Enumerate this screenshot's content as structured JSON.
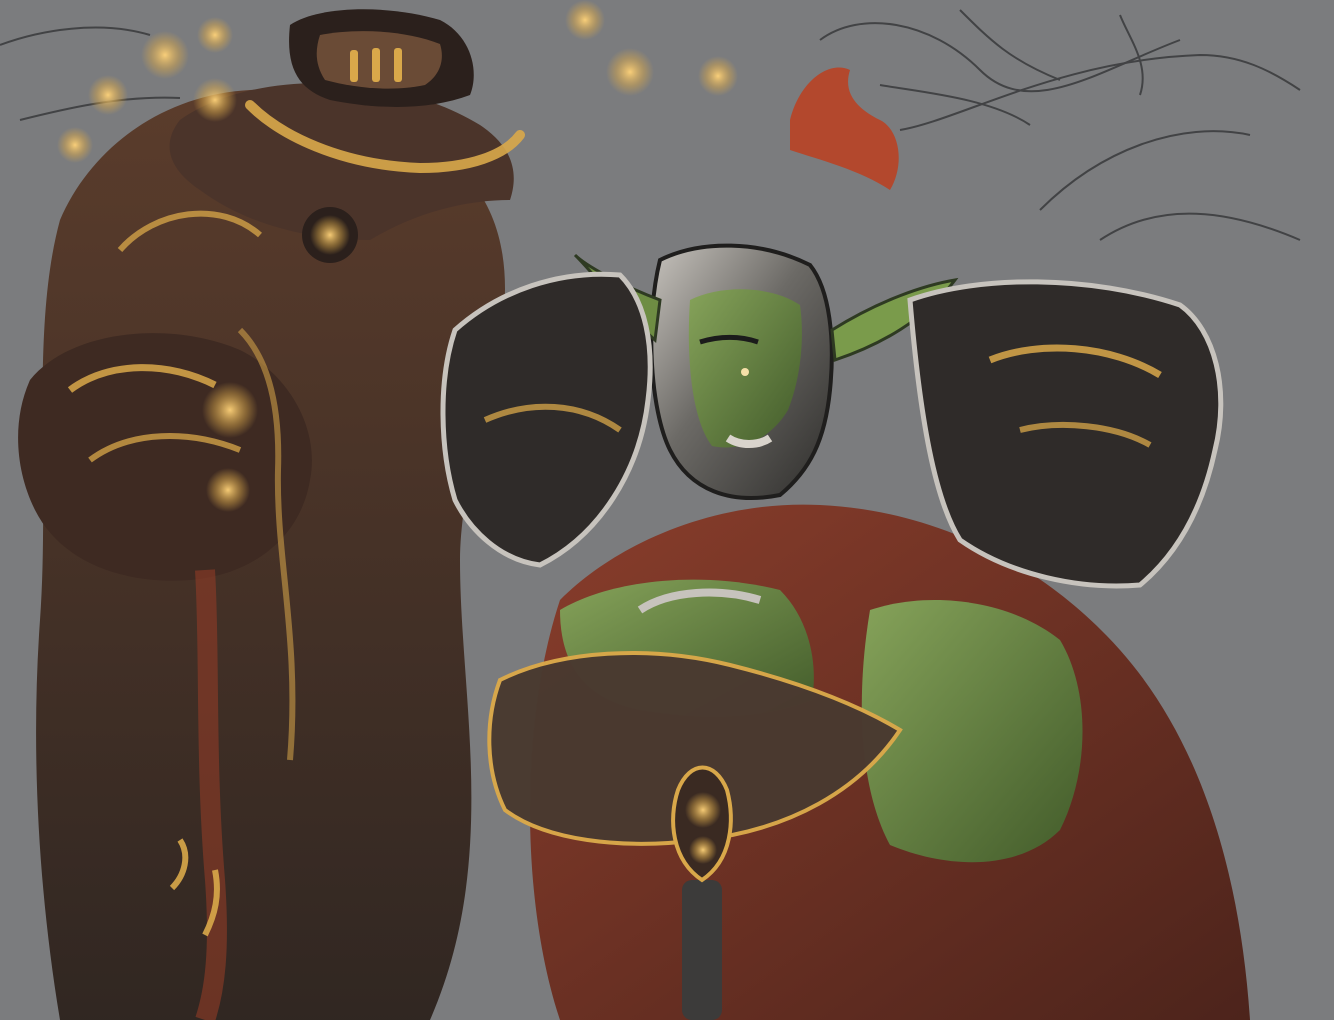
{
  "artwork": {
    "subject": "",
    "colors": {
      "background": "#7b7c7e",
      "sketch_line": "#2f3032",
      "dark_brown": "#3b2a22",
      "mid_brown": "#5a3b2a",
      "gold": "#d9a84a",
      "gold_light": "#ffd37a",
      "orc_green": "#5f7a3d",
      "orc_green_light": "#86a35a",
      "steel": "#6c6a66",
      "steel_light": "#c7c3bd",
      "hair_red": "#b3482d",
      "cape_red": "#6a2b1e"
    }
  }
}
